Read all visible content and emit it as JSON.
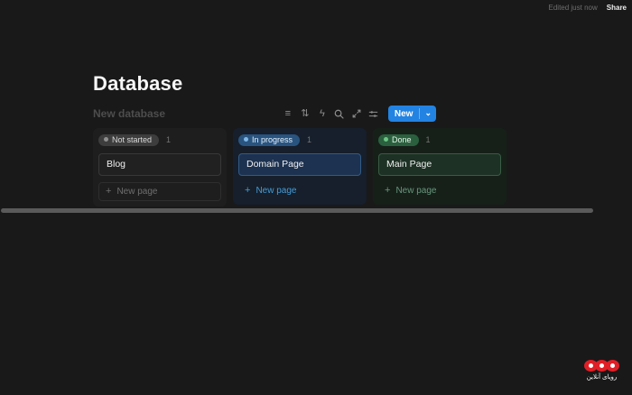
{
  "colors": {
    "background": "#191919",
    "accent_blue": "#2383e2",
    "pill_gray_bg": "#3d3d3d",
    "pill_blue_bg": "#29547f",
    "pill_green_bg": "#2a603e",
    "watermark_red": "#e01f26"
  },
  "topbar": {
    "edited": "Edited just now",
    "share": "Share"
  },
  "page": {
    "title": "Database",
    "view_title": "New database"
  },
  "toolbar": {
    "filter_icon": "≡",
    "sort_icon": "⇅",
    "automation_icon": "ϟ",
    "new_label": "New",
    "chevron_icon": "⌄"
  },
  "board": {
    "plus": "+",
    "columns": [
      {
        "label": "Not started",
        "count": "1",
        "card": "Blog",
        "new_page": "New page"
      },
      {
        "label": "In progress",
        "count": "1",
        "card": "Domain Page",
        "new_page": "New page"
      },
      {
        "label": "Done",
        "count": "1",
        "card": "Main Page",
        "new_page": "New page"
      }
    ]
  },
  "watermark": {
    "text": "رویای آنلاین"
  }
}
